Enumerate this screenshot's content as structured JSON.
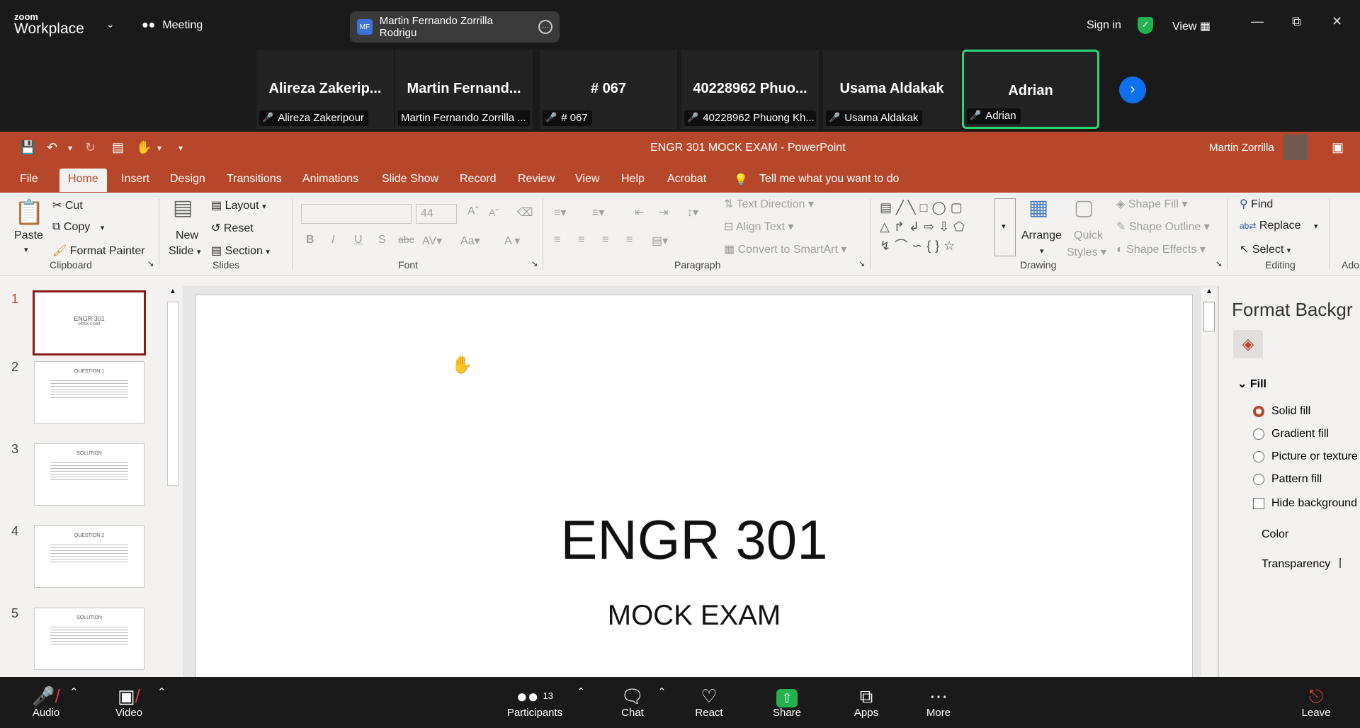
{
  "zoom_top": {
    "logo_small": "zoom",
    "logo_big": "Workplace",
    "meeting_label": "Meeting",
    "host_initials": "MF",
    "host_name": "Martin Fernando Zorrilla Rodrigu",
    "sign_in": "Sign in",
    "view_label": "View"
  },
  "participants": [
    {
      "display": "Alireza  Zakerip...",
      "label": "Alireza Zakeripour"
    },
    {
      "display": "Martin  Fernand...",
      "label": "Martin Fernando Zorrilla ..."
    },
    {
      "display": "# 067",
      "label": "# 067"
    },
    {
      "display": "40228962  Phuo...",
      "label": "40228962 Phuong Kh..."
    },
    {
      "display": "Usama Aldakak",
      "label": "Usama Aldakak"
    },
    {
      "display": "Adrian",
      "label": "Adrian"
    }
  ],
  "ppt": {
    "title": "ENGR 301 MOCK EXAM  -  PowerPoint",
    "user": "Martin Zorrilla",
    "tabs": [
      "File",
      "Home",
      "Insert",
      "Design",
      "Transitions",
      "Animations",
      "Slide Show",
      "Record",
      "Review",
      "View",
      "Help",
      "Acrobat"
    ],
    "tell_me": "Tell me what you want to do",
    "ribbon": {
      "paste": "Paste",
      "cut": "Cut",
      "copy": "Copy",
      "format_painter": "Format Painter",
      "clipboard": "Clipboard",
      "new_slide_1": "New",
      "new_slide_2": "Slide",
      "layout": "Layout",
      "reset": "Reset",
      "section": "Section",
      "slides": "Slides",
      "font_size": "44",
      "font": "Font",
      "text_direction": "Text Direction",
      "align_text": "Align Text",
      "convert_smartart": "Convert to SmartArt",
      "paragraph": "Paragraph",
      "arrange": "Arrange",
      "quick_styles_1": "Quick",
      "quick_styles_2": "Styles",
      "shape_fill": "Shape Fill",
      "shape_outline": "Shape Outline",
      "shape_effects": "Shape Effects",
      "drawing": "Drawing",
      "find": "Find",
      "replace": "Replace",
      "select": "Select",
      "editing": "Editing",
      "adobe": "Ado"
    },
    "thumbnails": [
      {
        "num": "1",
        "text": "ENGR 301",
        "sub": "MOCK EXAM"
      },
      {
        "num": "2",
        "text": "QUESTION 1"
      },
      {
        "num": "3",
        "text": "SOLUTION"
      },
      {
        "num": "4",
        "text": "QUESTION 2"
      },
      {
        "num": "5",
        "text": "SOLUTION"
      }
    ],
    "slide": {
      "title": "ENGR 301",
      "subtitle": "MOCK EXAM"
    },
    "format_pane": {
      "title": "Format Backgr",
      "section": "Fill",
      "solid_fill": "Solid fill",
      "gradient_fill": "Gradient fill",
      "picture_fill": "Picture or texture",
      "pattern_fill": "Pattern fill",
      "hide_bg": "Hide background",
      "color": "Color",
      "transparency": "Transparency"
    }
  },
  "zoom_bottom": {
    "audio": "Audio",
    "video": "Video",
    "participants": "Participants",
    "participant_count": "13",
    "chat": "Chat",
    "react": "React",
    "share": "Share",
    "apps": "Apps",
    "more": "More",
    "leave": "Leave"
  },
  "colors": {
    "ppt_accent": "#b7472a",
    "zoom_bg": "#1a1a1a",
    "active_speaker": "#2ed47a",
    "zoom_blue": "#0e71eb",
    "share_green": "#22b14c"
  }
}
